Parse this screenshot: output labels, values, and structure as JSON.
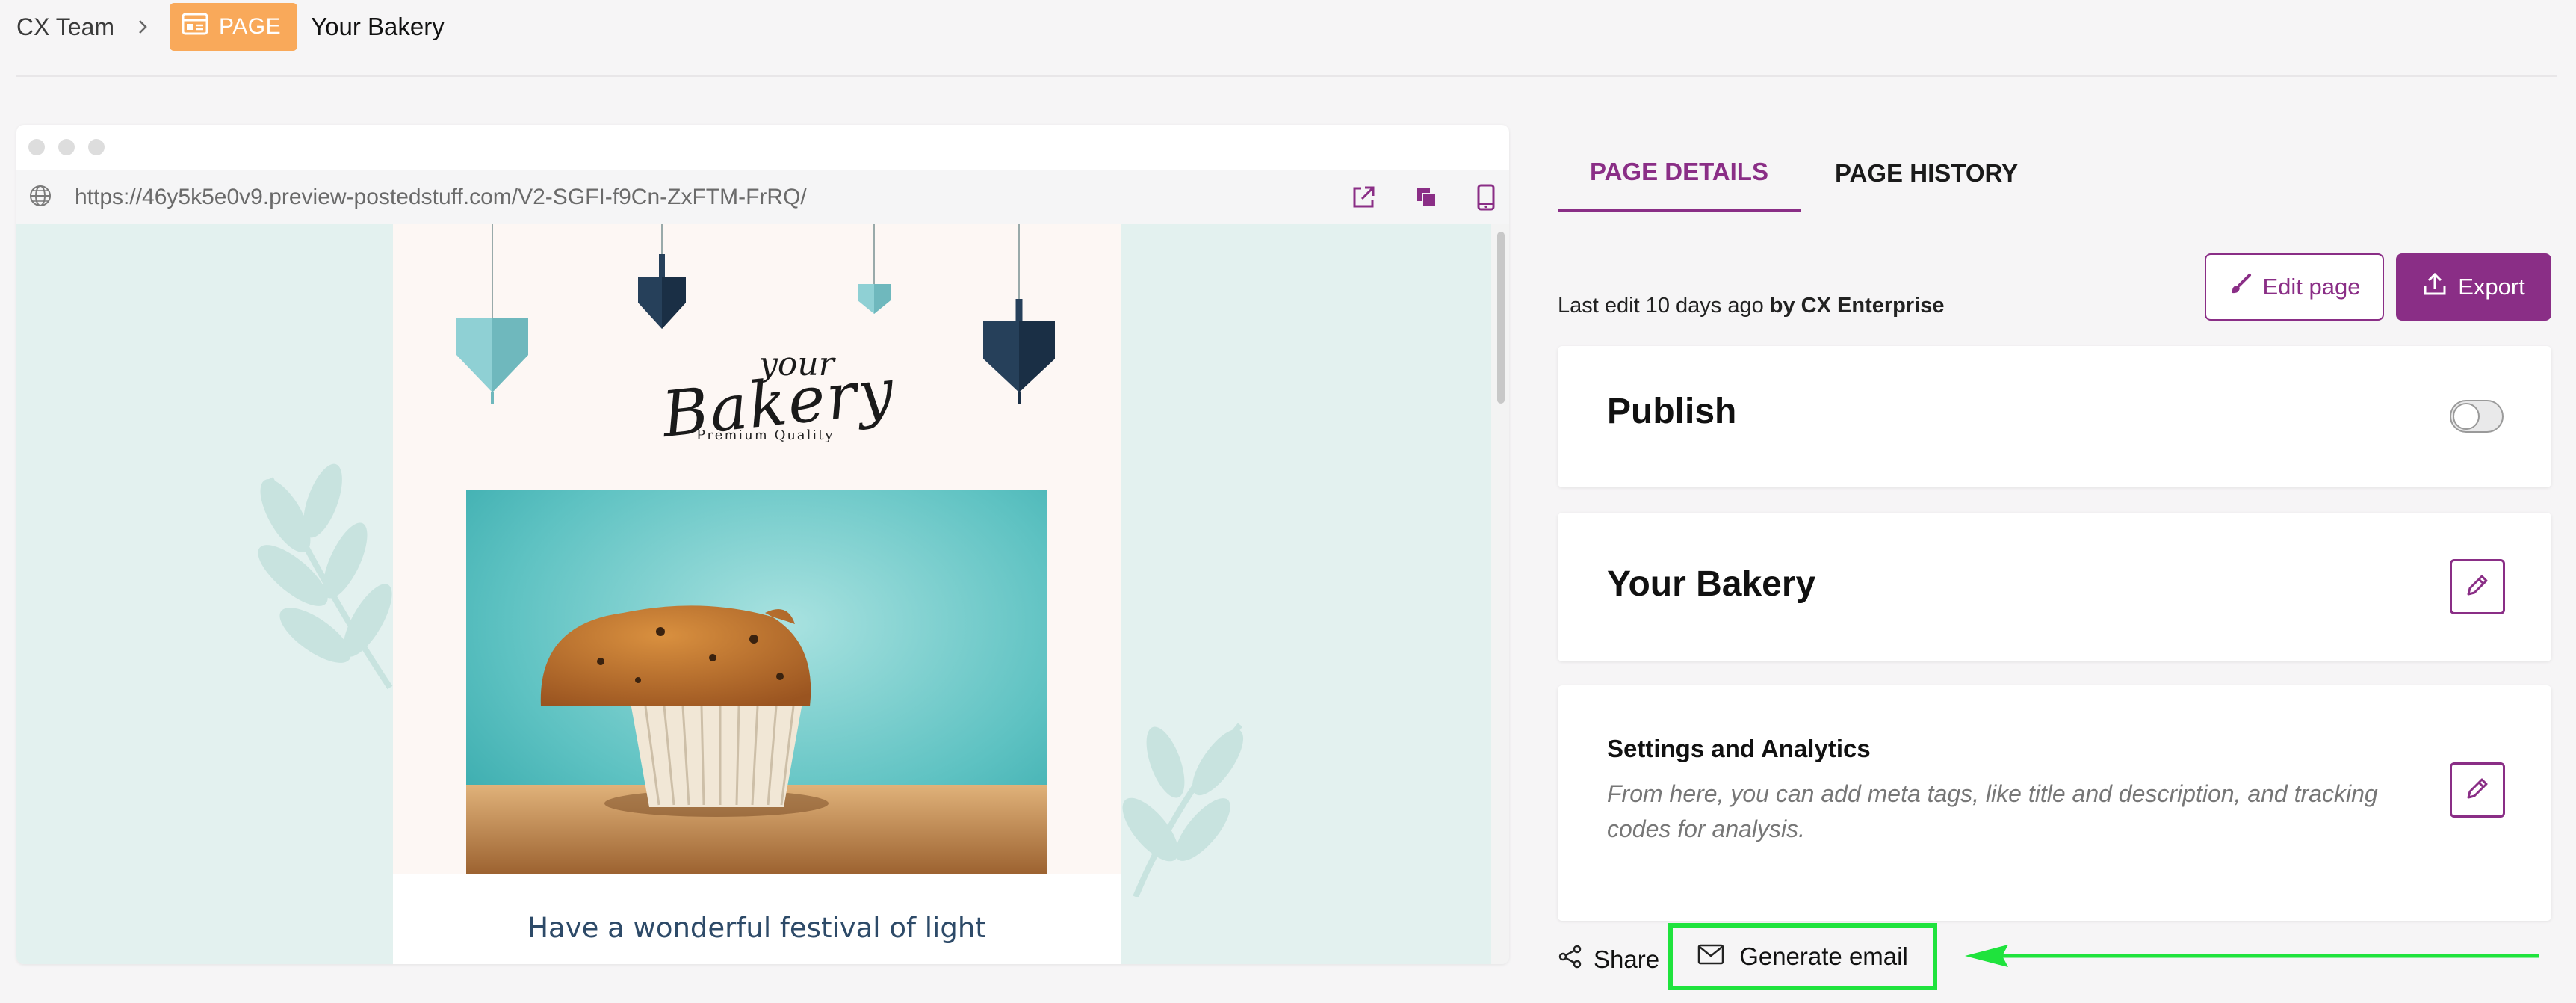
{
  "breadcrumb": {
    "root": "CX Team",
    "badge": "PAGE",
    "current": "Your Bakery"
  },
  "browser": {
    "url": "https://46y5k5e0v9.preview-postedstuff.com/V2-SGFI-f9Cn-ZxFTM-FrRQ/"
  },
  "preview": {
    "logo_your": "your",
    "logo_bakery": "Bakery",
    "logo_tagline": "Premium Quality",
    "festival_text": "Have a wonderful festival of light"
  },
  "tabs": {
    "details": "PAGE DETAILS",
    "history": "PAGE HISTORY"
  },
  "last_edit": {
    "prefix": "Last edit 10 days ago",
    "by": "by CX Enterprise"
  },
  "actions": {
    "edit_page": "Edit page",
    "export": "Export"
  },
  "publish": {
    "label": "Publish",
    "enabled": false
  },
  "page_title": "Your Bakery",
  "settings": {
    "heading": "Settings and Analytics",
    "description": "From here, you can add meta tags, like title and description, and tracking codes for analysis."
  },
  "bottom_actions": {
    "share": "Share",
    "generate_email": "Generate email"
  },
  "colors": {
    "accent": "#8a2e86",
    "badge": "#f9a95a",
    "highlight": "#1fe33d",
    "preview_bg": "#e3f1ef"
  }
}
